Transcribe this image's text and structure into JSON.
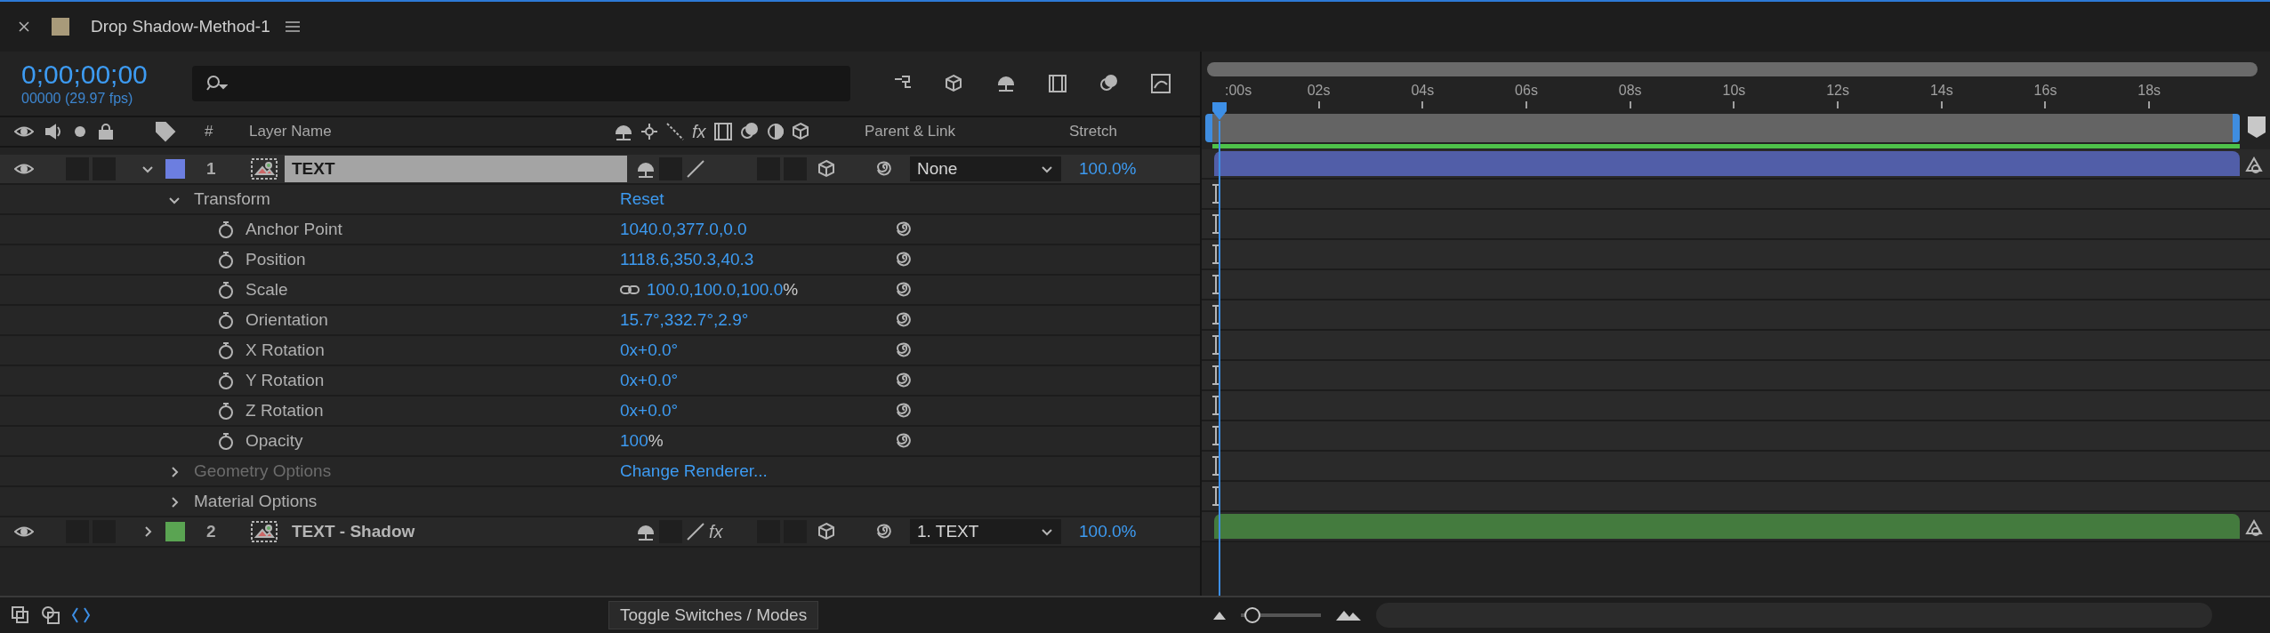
{
  "tab": {
    "title": "Drop Shadow-Method-1"
  },
  "timecode": "0;00;00;00",
  "frame_info": "00000 (29.97 fps)",
  "columns": {
    "number": "#",
    "layer_name": "Layer Name",
    "fx": "fx",
    "parent": "Parent & Link",
    "stretch": "Stretch"
  },
  "layers": [
    {
      "number": "1",
      "name": "TEXT",
      "color": "#6c7ee0",
      "solo": false,
      "locked": false,
      "selected": true,
      "expanded": true,
      "parent": "None",
      "stretch": "100.0%",
      "children": [
        {
          "kind": "group",
          "name": "Transform",
          "expanded": true,
          "disabled": false,
          "value": "Reset",
          "children": [
            {
              "kind": "property",
              "name": "Anchor Point",
              "value": "1040.0,377.0,0.0"
            },
            {
              "kind": "property",
              "name": "Position",
              "value": "1118.6,350.3,40.3"
            },
            {
              "kind": "property",
              "name": "Scale",
              "linked": true,
              "value": "100.0,100.0,100.0",
              "unit": "%"
            },
            {
              "kind": "property",
              "name": "Orientation",
              "value": "15.7°,332.7°,2.9°"
            },
            {
              "kind": "property",
              "name": "X Rotation",
              "value": "0x+0.0°"
            },
            {
              "kind": "property",
              "name": "Y Rotation",
              "value": "0x+0.0°"
            },
            {
              "kind": "property",
              "name": "Z Rotation",
              "value": "0x+0.0°"
            },
            {
              "kind": "property",
              "name": "Opacity",
              "value": "100",
              "unit": "%"
            }
          ]
        },
        {
          "kind": "group",
          "name": "Geometry Options",
          "expanded": false,
          "disabled": true,
          "value": "Change Renderer..."
        },
        {
          "kind": "group",
          "name": "Material Options",
          "expanded": false,
          "disabled": false
        }
      ]
    },
    {
      "number": "2",
      "name": "TEXT - Shadow",
      "color": "#5aa452",
      "solo": false,
      "locked": false,
      "selected": false,
      "expanded": false,
      "fx": "fx",
      "parent": "1. TEXT",
      "stretch": "100.0%"
    }
  ],
  "ruler": [
    ":00s",
    "02s",
    "04s",
    "06s",
    "08s",
    "10s",
    "12s",
    "14s",
    "16s",
    "18s"
  ],
  "toggle_button": "Toggle Switches / Modes",
  "zoom": {
    "level": 0.05
  }
}
